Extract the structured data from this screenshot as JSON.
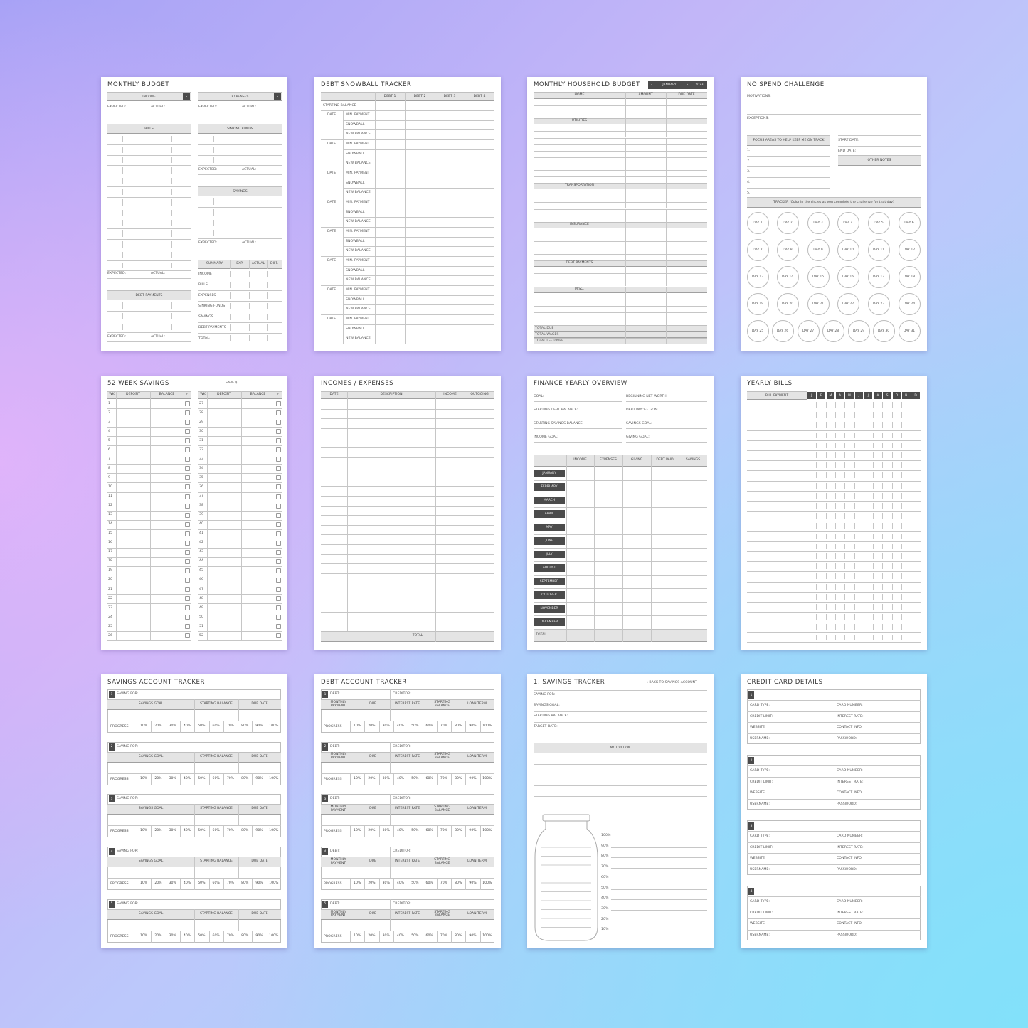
{
  "background": {
    "top_left": "#a7a2f6",
    "left_mid": "#e4b4fa",
    "bottom_right": "#82e1fa",
    "header_gray": "#e4e4e4",
    "dark_cell": "#4b4b4b"
  },
  "pages": {
    "monthly_budget": {
      "title": "MONTHLY BUDGET",
      "income": "INCOME",
      "expenses": "EXPENSES",
      "expected": "EXPECTED:",
      "actual": "ACTUAL:",
      "bills": "BILLS",
      "sinking_funds": "SINKING FUNDS",
      "savings": "SAVINGS",
      "debt_payments": "DEBT PAYMENTS",
      "summary_headers": [
        "SUMMARY",
        "EXP.",
        "ACTUAL",
        "DIFF."
      ],
      "summary_rows": [
        "INCOME",
        "BILLS",
        "EXPENSES",
        "SINKING FUNDS",
        "SAVINGS",
        "DEBT PAYMENTS",
        "TOTAL:"
      ]
    },
    "debt_snowball": {
      "title": "DEBT SNOWBALL TRACKER",
      "debts": [
        "DEBT 1",
        "DEBT 2",
        "DEBT 3",
        "DEBT 4"
      ],
      "starting_balance": "STARTING BALANCE",
      "date": "DATE",
      "row_labels": [
        "MIN. PAYMENT",
        "SNOWBALL",
        "NEW BALANCE"
      ]
    },
    "household_budget": {
      "title": "MONTHLY HOUSEHOLD BUDGET",
      "month": "JANUARY",
      "year": "2023",
      "columns": [
        "HOME",
        "AMOUNT",
        "DUE DATE"
      ],
      "sections": [
        "UTILITIES",
        "TRANSPORTATION",
        "INSURANCE",
        "DEBT PAYMENTS",
        "MISC."
      ],
      "totals": [
        "TOTAL DUE",
        "TOTAL WAGES",
        "TOTAL LEFTOVER"
      ]
    },
    "no_spend": {
      "title": "NO SPEND CHALLENGE",
      "motivations": "MOTIVATIONS:",
      "exceptions": "EXCEPTIONS:",
      "focus": "FOCUS AREAS TO HELP KEEP ME ON TRACK",
      "focus_items": [
        "1.",
        "2.",
        "3.",
        "4.",
        "5."
      ],
      "start_date": "START DATE:",
      "end_date": "END DATE:",
      "other_notes": "OTHER NOTES",
      "tracker": "TRACKER (Color in the circles as you complete the challenge for that day)",
      "days": [
        "DAY 1",
        "DAY 2",
        "DAY 3",
        "DAY 4",
        "DAY 5",
        "DAY 6",
        "DAY 7",
        "DAY 8",
        "DAY 9",
        "DAY 10",
        "DAY 11",
        "DAY 12",
        "DAY 13",
        "DAY 14",
        "DAY 15",
        "DAY 16",
        "DAY 17",
        "DAY 18",
        "DAY 19",
        "DAY 20",
        "DAY 21",
        "DAY 22",
        "DAY 23",
        "DAY 24",
        "DAY 25",
        "DAY 26",
        "DAY 27",
        "DAY 28",
        "DAY 29",
        "DAY 30",
        "DAY 31"
      ]
    },
    "week_savings": {
      "title": "52 WEEK SAVINGS",
      "save": "SAVE $:",
      "columns": [
        "WK",
        "DEPOSIT",
        "BALANCE"
      ],
      "weeks": [
        "1",
        "2",
        "3",
        "4",
        "5",
        "6",
        "7",
        "8",
        "9",
        "10",
        "11",
        "12",
        "13",
        "14",
        "15",
        "16",
        "17",
        "18",
        "19",
        "20",
        "21",
        "22",
        "23",
        "24",
        "25",
        "26",
        "27",
        "28",
        "29",
        "30",
        "31",
        "32",
        "33",
        "34",
        "35",
        "36",
        "37",
        "38",
        "39",
        "40",
        "41",
        "42",
        "43",
        "44",
        "45",
        "46",
        "47",
        "48",
        "49",
        "50",
        "51",
        "52"
      ]
    },
    "incomes_expenses": {
      "title": "INCOMES / EXPENSES",
      "columns": [
        "DATE",
        "DESCRIPTION",
        "INCOME",
        "OUTGOING"
      ],
      "total": "TOTAL"
    },
    "yearly_overview": {
      "title": "FINANCE YEARLY OVERVIEW",
      "fields": [
        "GOAL:",
        "BEGINNING NET WORTH:",
        "STARTING DEBT BALANCE:",
        "DEBT PAYOFF GOAL:",
        "STARTING SAVINGS BALANCE:",
        "SAVINGS GOAL:",
        "INCOME GOAL:",
        "GIVING GOAL:"
      ],
      "columns": [
        "INCOME",
        "EXPENSES",
        "GIVING",
        "DEBT PAID",
        "SAVINGS"
      ],
      "months": [
        "JANUARY",
        "FEBRUARY",
        "MARCH",
        "APRIL",
        "MAY",
        "JUNE",
        "JULY",
        "AUGUST",
        "SEPTEMBER",
        "OCTOBER",
        "NOVEMBER",
        "DECEMBER"
      ],
      "total": "TOTAL"
    },
    "yearly_bills": {
      "title": "YEARLY BILLS",
      "bill_payment": "BILL PAYMENT",
      "months": [
        "J",
        "F",
        "M",
        "A",
        "M",
        "J",
        "J",
        "A",
        "S",
        "O",
        "N",
        "D"
      ]
    },
    "savings_account": {
      "title": "SAVINGS ACCOUNT TRACKER",
      "numbers": [
        "1",
        "2",
        "3",
        "4",
        "5"
      ],
      "saving_for": "SAVING FOR:",
      "columns": [
        "SAVINGS GOAL",
        "STARTING BALANCE",
        "DUE DATE"
      ],
      "progress": "PROGRESS",
      "percents": [
        "10%",
        "20%",
        "30%",
        "40%",
        "50%",
        "60%",
        "70%",
        "80%",
        "90%",
        "100%"
      ]
    },
    "debt_account": {
      "title": "DEBT ACCOUNT TRACKER",
      "numbers": [
        "1",
        "2",
        "3",
        "4",
        "5"
      ],
      "debt": "DEBT:",
      "creditor": "CREDITOR:",
      "columns": [
        "MONTHLY PAYMENT",
        "DUE",
        "INTEREST RATE",
        "STARTING BALANCE",
        "LOAN TERM"
      ],
      "progress": "PROGRESS",
      "percents": [
        "10%",
        "20%",
        "30%",
        "40%",
        "50%",
        "60%",
        "70%",
        "80%",
        "90%",
        "100%"
      ]
    },
    "savings_tracker": {
      "title": "1. SAVINGS TRACKER",
      "back": "‹ BACK TO SAVINGS ACCOUNT",
      "fields": [
        "SAVING FOR:",
        "SAVINGS GOAL:",
        "STARTING BALANCE:",
        "TARGET DATE:"
      ],
      "motivation": "MOTIVATION",
      "jar_levels": [
        "100%",
        "90%",
        "80%",
        "70%",
        "60%",
        "50%",
        "40%",
        "30%",
        "20%",
        "10%"
      ]
    },
    "credit_card": {
      "title": "CREDIT CARD DETAILS",
      "numbers": [
        "1",
        "2",
        "3",
        "4"
      ],
      "fields": [
        "CARD TYPE:",
        "CARD NUMBER:",
        "CREDIT LIMIT:",
        "INTEREST RATE:",
        "WEBSITE:",
        "CONTACT INFO:",
        "USERNAME:",
        "PASSWORD:"
      ]
    }
  }
}
